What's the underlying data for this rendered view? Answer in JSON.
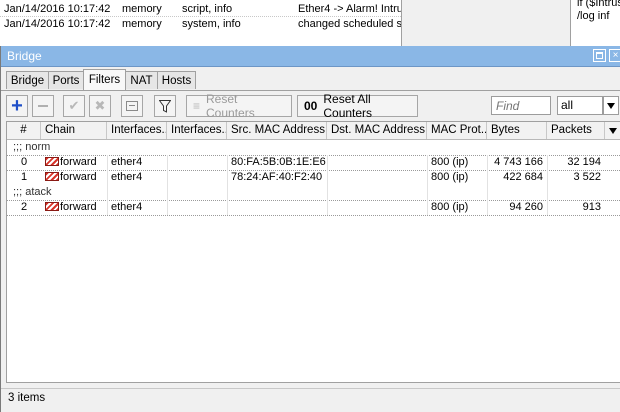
{
  "log": {
    "rows": [
      {
        "time": "Jan/14/2016 10:17:42",
        "topic": "memory",
        "topics": "script, info",
        "message": "Ether4 -> Alarm! Intrus"
      },
      {
        "time": "Jan/14/2016 10:17:42",
        "topic": "memory",
        "topics": "system, info",
        "message": "changed scheduled s"
      }
    ]
  },
  "script_panel": {
    "lines": [
      "if ($Intrus",
      "/log inf"
    ]
  },
  "window": {
    "title": "Bridge",
    "close_label": "×"
  },
  "tabs": [
    {
      "label": "Bridge",
      "active": false
    },
    {
      "label": "Ports",
      "active": false
    },
    {
      "label": "Filters",
      "active": true
    },
    {
      "label": "NAT",
      "active": false
    },
    {
      "label": "Hosts",
      "active": false
    }
  ],
  "toolbar": {
    "reset_counters_label": "Reset Counters",
    "reset_all_counters_label": "Reset All Counters",
    "reset_all_icon_text": "00",
    "find_placeholder": "Find",
    "filter_value": "all",
    "icons": {
      "add": "plus-icon",
      "remove": "minus-icon",
      "enable": "check-icon",
      "disable": "x-icon",
      "comment": "note-icon",
      "filter": "funnel-icon"
    }
  },
  "table": {
    "columns": [
      "#",
      "Chain",
      "Interfaces....",
      "Interfaces....",
      "Src. MAC Address...",
      "Dst. MAC Address...",
      "MAC Prot...",
      "Bytes",
      "Packets"
    ],
    "groups": [
      {
        "comment": ";;; norm",
        "rows": [
          {
            "num": "0",
            "chain": "forward",
            "in_iface": "ether4",
            "out_iface": "",
            "src_mac": "80:FA:5B:0B:1E:E6",
            "dst_mac": "",
            "mac_proto": "800 (ip)",
            "bytes": "4 743 166",
            "packets": "32 194"
          },
          {
            "num": "1",
            "chain": "forward",
            "in_iface": "ether4",
            "out_iface": "",
            "src_mac": "78:24:AF:40:F2:40",
            "dst_mac": "",
            "mac_proto": "800 (ip)",
            "bytes": "422 684",
            "packets": "3 522"
          }
        ]
      },
      {
        "comment": ";;; atack",
        "rows": [
          {
            "num": "2",
            "chain": "forward",
            "in_iface": "ether4",
            "out_iface": "",
            "src_mac": "",
            "dst_mac": "",
            "mac_proto": "800 (ip)",
            "bytes": "94 260",
            "packets": "913"
          }
        ]
      }
    ]
  },
  "status": {
    "items_text": "3 items"
  }
}
